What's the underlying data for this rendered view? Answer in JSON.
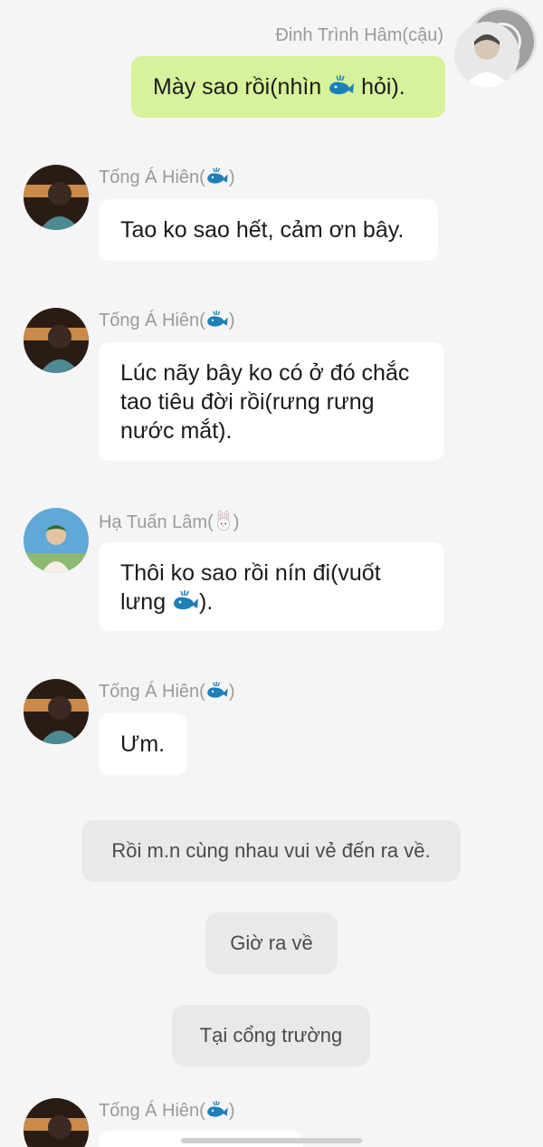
{
  "colors": {
    "background": "#f5f5f5",
    "my_bubble": "#d6f29b",
    "other_bubble": "#ffffff",
    "narration_bg": "#e9e9e9",
    "name_text": "#9a9a9a",
    "whale_blue": "#1e7fb8"
  },
  "messages": [
    {
      "sender": "Đinh Trình Hâm(cậu)",
      "side": "right",
      "text": "Mày sao rồi(nhìn ",
      "emoji": "whale-emoji",
      "text_after": " hỏi)."
    },
    {
      "sender": "Tống Á Hiên(",
      "sender_emoji": "whale-emoji",
      "sender_after": ")",
      "side": "left",
      "text": "Tao ko sao hết, cảm ơn bây."
    },
    {
      "sender": "Tống Á Hiên(",
      "sender_emoji": "whale-emoji",
      "sender_after": ")",
      "side": "left",
      "text": "Lúc nãy bây ko có ở đó chắc tao tiêu đời rồi(rưng rưng nước mắt)."
    },
    {
      "sender": "Hạ Tuấn Lâm(",
      "sender_emoji": "rabbit-emoji",
      "sender_after": ")",
      "side": "left",
      "text": "Thôi ko sao rồi nín đi(vuốt lưng ",
      "emoji": "whale-emoji",
      "text_after": ")."
    },
    {
      "sender": "Tống Á Hiên(",
      "sender_emoji": "whale-emoji",
      "sender_after": ")",
      "side": "left",
      "text": "Ưm."
    },
    {
      "sender": "Tống Á Hiên(",
      "sender_emoji": "whale-emoji",
      "sender_after": ")",
      "side": "left",
      "text": ""
    }
  ],
  "narrations": [
    "Rồi m.n cùng nhau vui vẻ đến ra về.",
    "Giờ ra về",
    "Tại cổng trường"
  ]
}
